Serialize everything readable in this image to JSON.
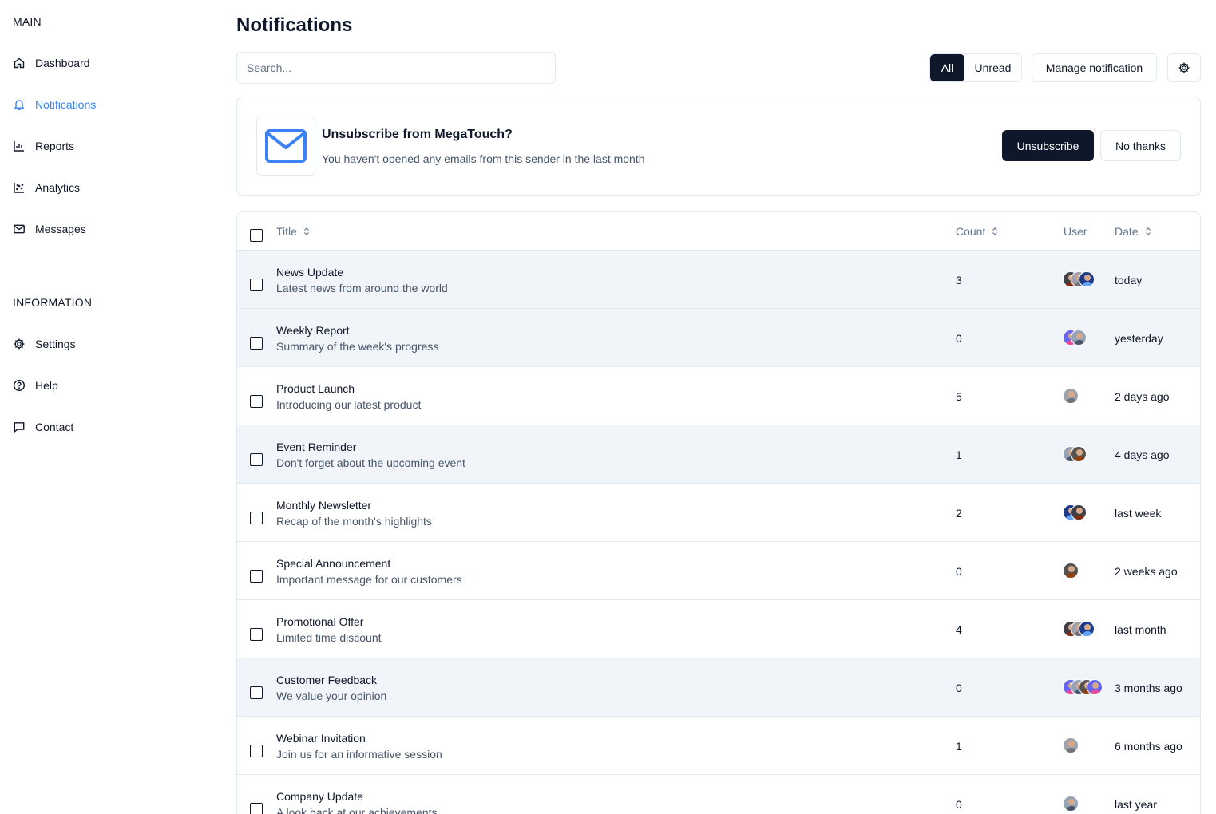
{
  "sidebar": {
    "main_label": "MAIN",
    "main_items": [
      {
        "label": "Dashboard",
        "icon": "home-icon"
      },
      {
        "label": "Notifications",
        "icon": "bell-icon",
        "active": true
      },
      {
        "label": "Reports",
        "icon": "bar-chart-icon"
      },
      {
        "label": "Analytics",
        "icon": "scatter-chart-icon"
      },
      {
        "label": "Messages",
        "icon": "mail-icon"
      }
    ],
    "info_label": "INFORMATION",
    "info_items": [
      {
        "label": "Settings",
        "icon": "gear-icon"
      },
      {
        "label": "Help",
        "icon": "help-circle-icon"
      },
      {
        "label": "Contact",
        "icon": "chat-icon"
      }
    ]
  },
  "header": {
    "title": "Notifications",
    "search_placeholder": "Search...",
    "filter_all": "All",
    "filter_unread": "Unread",
    "manage_label": "Manage notification"
  },
  "banner": {
    "title": "Unsubscribe from MegaTouch?",
    "subtitle": "You haven't opened any emails from this sender in the last month",
    "unsubscribe_label": "Unsubscribe",
    "dismiss_label": "No thanks"
  },
  "table": {
    "col_title": "Title",
    "col_count": "Count",
    "col_user": "User",
    "col_date": "Date",
    "rows": [
      {
        "title": "News Update",
        "desc": "Latest news from around the world",
        "count": "3",
        "users": 3,
        "date": "today",
        "shaded": true
      },
      {
        "title": "Weekly Report",
        "desc": "Summary of the week's progress",
        "count": "0",
        "users": 2,
        "date": "yesterday",
        "shaded": true
      },
      {
        "title": "Product Launch",
        "desc": "Introducing our latest product",
        "count": "5",
        "users": 1,
        "date": "2 days ago",
        "shaded": false
      },
      {
        "title": "Event Reminder",
        "desc": "Don't forget about the upcoming event",
        "count": "1",
        "users": 2,
        "date": "4 days ago",
        "shaded": true
      },
      {
        "title": "Monthly Newsletter",
        "desc": "Recap of the month's highlights",
        "count": "2",
        "users": 2,
        "date": "last week",
        "shaded": false
      },
      {
        "title": "Special Announcement",
        "desc": "Important message for our customers",
        "count": "0",
        "users": 1,
        "date": "2 weeks ago",
        "shaded": false
      },
      {
        "title": "Promotional Offer",
        "desc": "Limited time discount",
        "count": "4",
        "users": 3,
        "date": "last month",
        "shaded": false
      },
      {
        "title": "Customer Feedback",
        "desc": "We value your opinion",
        "count": "0",
        "users": 4,
        "date": "3 months ago",
        "shaded": true
      },
      {
        "title": "Webinar Invitation",
        "desc": "Join us for an informative session",
        "count": "1",
        "users": 1,
        "date": "6 months ago",
        "shaded": false
      },
      {
        "title": "Company Update",
        "desc": "A look back at our achievements",
        "count": "0",
        "users": 1,
        "date": "last year",
        "shaded": false
      }
    ]
  },
  "colors": {
    "accent": "#3b82f6",
    "primary_dark": "#0f172a",
    "row_shade": "#f1f5f9",
    "border": "#e2e8f0"
  }
}
